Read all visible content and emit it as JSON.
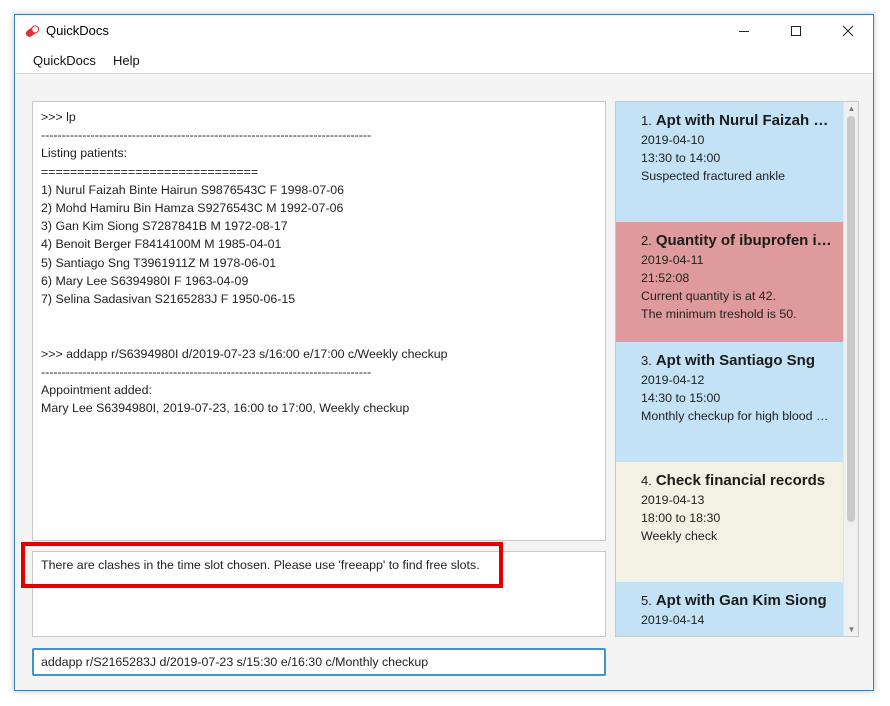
{
  "window": {
    "title": "QuickDocs"
  },
  "menu": {
    "items": [
      "QuickDocs",
      "Help"
    ]
  },
  "console": {
    "lines": [
      ">>> lp",
      "--------------------------------------------------------------------------------",
      "Listing patients:",
      "==============================",
      "1) Nurul Faizah Binte Hairun S9876543C F 1998-07-06",
      "2) Mohd Hamiru Bin Hamza S9276543C M 1992-07-06",
      "3) Gan Kim Siong S7287841B M 1972-08-17",
      "4) Benoit Berger F8414100M M 1985-04-01",
      "5) Santiago Sng T3961911Z M 1978-06-01",
      "6) Mary Lee S6394980I F 1963-04-09",
      "7) Selina Sadasivan S2165283J F 1950-06-15",
      "",
      "",
      ">>> addapp r/S6394980I d/2019-07-23 s/16:00 e/17:00 c/Weekly checkup",
      "--------------------------------------------------------------------------------",
      "Appointment added:",
      "Mary Lee S6394980I, 2019-07-23, 16:00 to 17:00, Weekly checkup"
    ]
  },
  "result": {
    "text": "There are clashes in the time slot chosen. Please use 'freeapp' to find free slots."
  },
  "command": {
    "value": "addapp r/S2165283J d/2019-07-23 s/15:30 e/16:30 c/Monthly checkup"
  },
  "reminders": [
    {
      "index": "1.",
      "title": "Apt with Nurul Faizah Binte Hairun",
      "date": "2019-04-10",
      "time": "13:30 to 14:00",
      "comment": "Suspected fractured ankle",
      "comment2": "",
      "color": "#c4e2f6"
    },
    {
      "index": "2.",
      "title": "Quantity of ibuprofen is low",
      "date": "2019-04-11",
      "time": "21:52:08",
      "comment": "Current quantity is at 42.",
      "comment2": "The minimum treshold is 50.",
      "color": "#de9a9c"
    },
    {
      "index": "3.",
      "title": "Apt with Santiago Sng",
      "date": "2019-04-12",
      "time": "14:30 to 15:00",
      "comment": "Monthly checkup for high blood pressure",
      "comment2": "",
      "color": "#c4e2f6"
    },
    {
      "index": "4.",
      "title": "Check financial records",
      "date": "2019-04-13",
      "time": "18:00 to 18:30",
      "comment": "Weekly check",
      "comment2": "",
      "color": "#f3f1e4"
    },
    {
      "index": "5.",
      "title": "Apt with Gan Kim Siong",
      "date": "2019-04-14",
      "time": "",
      "comment": "",
      "comment2": "",
      "color": "#c4e2f6"
    }
  ],
  "colors": {
    "highlight": "#e30000",
    "input_focus": "#3f93d1"
  },
  "icons": {
    "app": "pill-icon",
    "minimize": "minimize-icon",
    "maximize": "maximize-icon",
    "close": "close-icon"
  }
}
